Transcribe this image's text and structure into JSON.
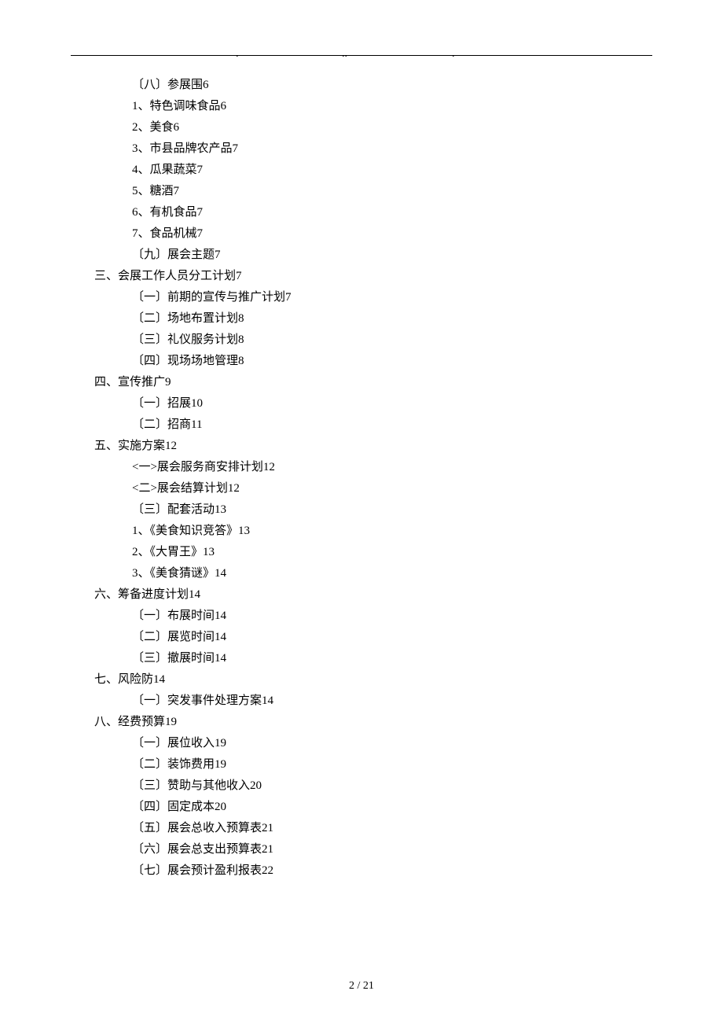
{
  "toc": [
    {
      "level": 2,
      "text": "〔八〕参展围",
      "page": "6"
    },
    {
      "level": 3,
      "text": "1、特色调味食品",
      "page": "6"
    },
    {
      "level": 3,
      "text": "2、美食",
      "page": "6"
    },
    {
      "level": 3,
      "text": "3、市县品牌农产品",
      "page": "7"
    },
    {
      "level": 3,
      "text": "4、瓜果蔬菜",
      "page": "7"
    },
    {
      "level": 3,
      "text": "5、糖酒",
      "page": "7"
    },
    {
      "level": 3,
      "text": "6、有机食品",
      "page": "7"
    },
    {
      "level": 3,
      "text": "7、食品机械",
      "page": "7"
    },
    {
      "level": 2,
      "text": "〔九〕展会主题",
      "page": "7"
    },
    {
      "level": 1,
      "text": "三、会展工作人员分工计划",
      "page": "7"
    },
    {
      "level": 2,
      "text": "〔一〕前期的宣传与推广计划",
      "page": "7"
    },
    {
      "level": 2,
      "text": "〔二〕场地布置计划",
      "page": "8"
    },
    {
      "level": 2,
      "text": "〔三〕礼仪服务计划",
      "page": "8"
    },
    {
      "level": 2,
      "text": "〔四〕现场场地管理",
      "page": "8"
    },
    {
      "level": 1,
      "text": "四、宣传推广",
      "page": "9"
    },
    {
      "level": 2,
      "text": "〔一〕招展",
      "page": "10"
    },
    {
      "level": 2,
      "text": "〔二〕招商",
      "page": "11"
    },
    {
      "level": 1,
      "text": "五、实施方案",
      "page": "12"
    },
    {
      "level": 2,
      "text": "<一>展会服务商安排计划",
      "page": "12"
    },
    {
      "level": 2,
      "text": "<二>展会结算计划",
      "page": "12"
    },
    {
      "level": 2,
      "text": "〔三〕配套活动",
      "page": "13"
    },
    {
      "level": 3,
      "text": "1、《美食知识竞答》",
      "page": "13"
    },
    {
      "level": 3,
      "text": "2、《大胃王》",
      "page": "13"
    },
    {
      "level": 3,
      "text": "3、《美食猜谜》",
      "page": "14"
    },
    {
      "level": 1,
      "text": "六、筹备进度计划",
      "page": "14"
    },
    {
      "level": 2,
      "text": "〔一〕布展时间",
      "page": "14"
    },
    {
      "level": 2,
      "text": "〔二〕展览时间",
      "page": "14"
    },
    {
      "level": 2,
      "text": "〔三〕撤展时间",
      "page": "14"
    },
    {
      "level": 1,
      "text": "七、风险防",
      "page": "14"
    },
    {
      "level": 2,
      "text": "〔一〕突发事件处理方案",
      "page": "14"
    },
    {
      "level": 1,
      "text": "八、经费预算",
      "page": "19"
    },
    {
      "level": 2,
      "text": "〔一〕展位收入",
      "page": "19"
    },
    {
      "level": 2,
      "text": "〔二〕装饰费用",
      "page": "19"
    },
    {
      "level": 2,
      "text": "〔三〕赞助与其他收入",
      "page": "20"
    },
    {
      "level": 2,
      "text": "〔四〕固定成本",
      "page": "20"
    },
    {
      "level": 2,
      "text": "〔五〕展会总收入预算表",
      "page": "21"
    },
    {
      "level": 2,
      "text": "〔六〕展会总支出预算表",
      "page": "21"
    },
    {
      "level": 2,
      "text": "〔七〕展会预计盈利报表",
      "page": "22"
    }
  ],
  "footer": "2 / 21"
}
